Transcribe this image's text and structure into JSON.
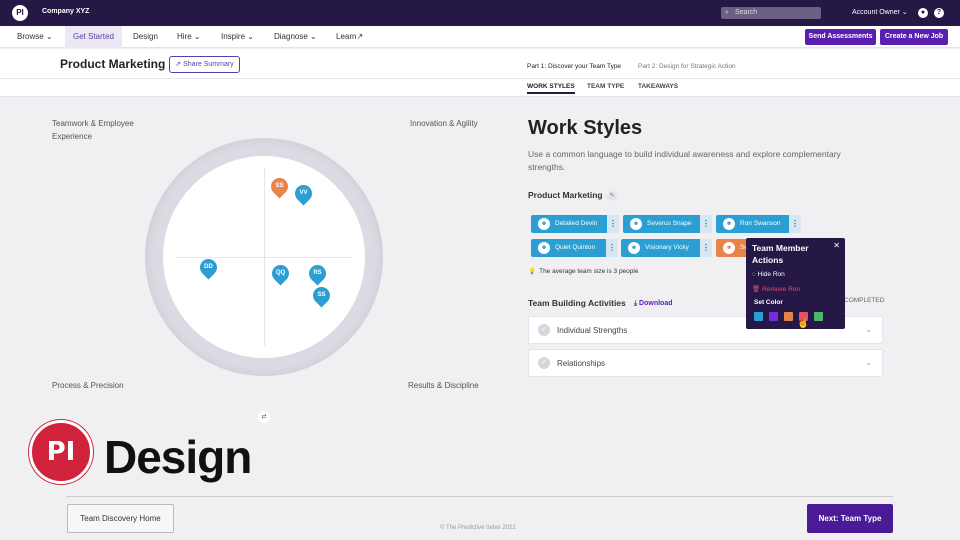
{
  "topbar": {
    "logo": "PI",
    "company": "Company XYZ",
    "search_placeholder": "Search",
    "account": "Account Owner",
    "help_icon": "?"
  },
  "nav": {
    "items": [
      "Browse",
      "Get Started",
      "Design",
      "Hire",
      "Inspire",
      "Diagnose",
      "Learn"
    ],
    "send_assessments": "Send Assessments",
    "create_job": "Create a New Job"
  },
  "header": {
    "title": "Product Marketing",
    "share": "Share Summary",
    "part1": "Part 1: Discover your Team Type",
    "part2": "Part 2: Design for Strategic Action",
    "tabs": [
      "WORK STYLES",
      "TEAM TYPE",
      "TAKEAWAYS"
    ]
  },
  "quadrant": {
    "tl": "Teamwork & Employee Experience",
    "tr": "Innovation & Agility",
    "bl": "Process & Precision",
    "br": "Results & Discipline",
    "pins": [
      {
        "label": "SS",
        "color": "#e8834a"
      },
      {
        "label": "VV",
        "color": "#2b9fd4"
      },
      {
        "label": "DD",
        "color": "#2b9fd4"
      },
      {
        "label": "QQ",
        "color": "#2b9fd4"
      },
      {
        "label": "RS",
        "color": "#2b9fd4"
      },
      {
        "label": "SS",
        "color": "#2b9fd4"
      }
    ]
  },
  "brand": {
    "logo_text": "PI",
    "word": "Design"
  },
  "main": {
    "heading": "Work Styles",
    "description": "Use a common language to build individual awareness and explore complementary strengths.",
    "team_label": "Product Marketing",
    "members": [
      "Detailed Devin",
      "Severus Snape",
      "Ron Swanson",
      "Quiet Quinton",
      "Visionary Vicky",
      "Se"
    ],
    "avg_team": "The average team size is 3 people",
    "tba_label": "Team Building Activities",
    "download": "Download",
    "completed": "COMPLETED",
    "accordions": [
      "Individual Strengths",
      "Relationships"
    ]
  },
  "popup": {
    "title": "Team Member Actions",
    "hide": "Hide Ron",
    "remove": "Remove Ron",
    "set_color": "Set Color",
    "colors": [
      "#2b9fd4",
      "#7a2be0",
      "#e8834a",
      "#e8506a",
      "#4cb86b"
    ]
  },
  "footer": {
    "home": "Team Discovery Home",
    "copyright": "© The Predictive Index 2022",
    "next": "Next: Team Type"
  }
}
